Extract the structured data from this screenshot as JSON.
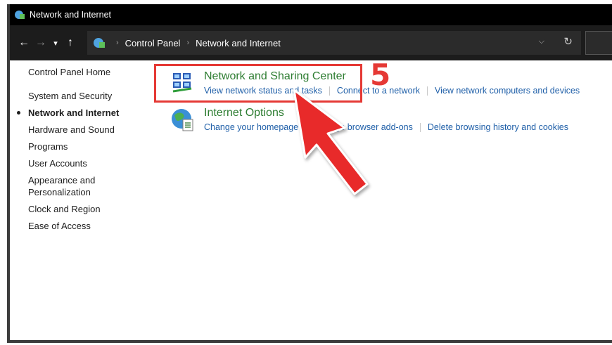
{
  "window": {
    "title": "Network and Internet"
  },
  "address_bar": {
    "crumbs": [
      "Control Panel",
      "Network and Internet"
    ]
  },
  "sidebar": {
    "items": [
      {
        "label": "Control Panel Home"
      },
      {
        "label": "System and Security"
      },
      {
        "label": "Network and Internet",
        "active": true
      },
      {
        "label": "Hardware and Sound"
      },
      {
        "label": "Programs"
      },
      {
        "label": "User Accounts"
      },
      {
        "label": "Appearance and Personalization"
      },
      {
        "label": "Clock and Region"
      },
      {
        "label": "Ease of Access"
      }
    ]
  },
  "categories": [
    {
      "title": "Network and Sharing Center",
      "icon": "network-sharing-icon",
      "links": [
        "View network status and tasks",
        "Connect to a network",
        "View network computers and devices"
      ]
    },
    {
      "title": "Internet Options",
      "icon": "internet-options-icon",
      "links": [
        "Change your homepage",
        "Manage browser add-ons",
        "Delete browsing history and cookies"
      ]
    }
  ],
  "annotation": {
    "step_number": "5",
    "color": "#e53935"
  },
  "colors": {
    "category_title": "#2e7d32",
    "link": "#1f5fa8",
    "titlebar": "#000000",
    "address_bar": "#1c1c1c"
  }
}
